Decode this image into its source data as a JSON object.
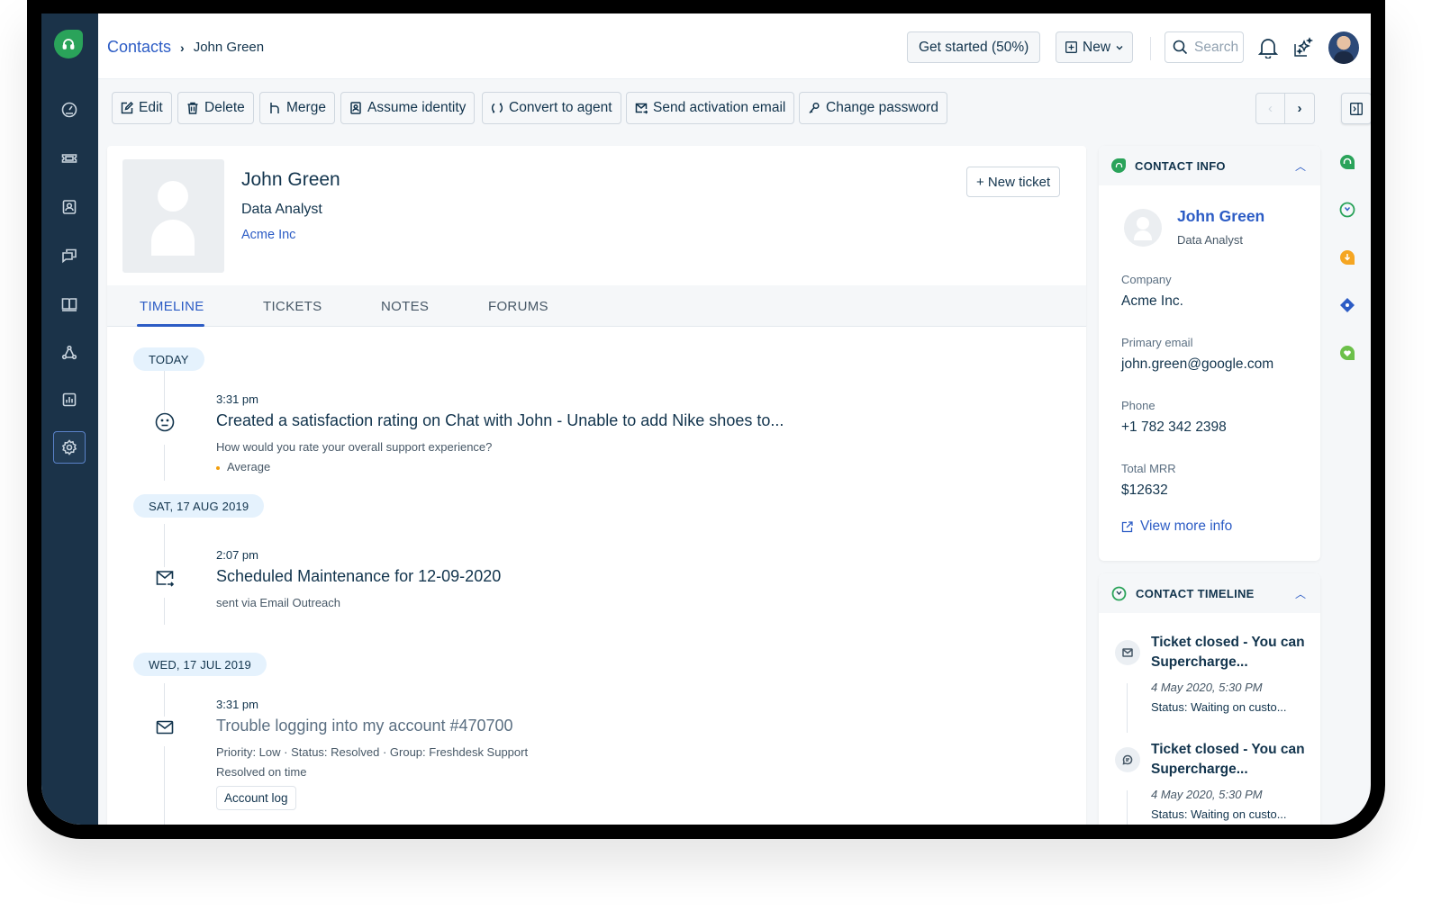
{
  "breadcrumb": {
    "parent": "Contacts",
    "separator": "›",
    "current": "John Green"
  },
  "header": {
    "get_started": "Get started (50%)",
    "new_label": "New",
    "search_placeholder": "Search"
  },
  "sidebar": {
    "items": [
      {
        "name": "dashboard",
        "icon": "gauge-icon"
      },
      {
        "name": "tickets",
        "icon": "ticket-icon"
      },
      {
        "name": "contacts",
        "icon": "contact-card-icon"
      },
      {
        "name": "conversations",
        "icon": "chat-icon"
      },
      {
        "name": "knowledge-base",
        "icon": "book-icon"
      },
      {
        "name": "social",
        "icon": "network-icon"
      },
      {
        "name": "reports",
        "icon": "bar-chart-icon"
      },
      {
        "name": "admin",
        "icon": "gear-icon",
        "active": true
      }
    ]
  },
  "toolbar": {
    "edit": "Edit",
    "delete": "Delete",
    "merge": "Merge",
    "assume_identity": "Assume identity",
    "convert_to_agent": "Convert to agent",
    "send_activation_email": "Send activation email",
    "change_password": "Change password"
  },
  "profile": {
    "name": "John Green",
    "title": "Data Analyst",
    "company": "Acme Inc",
    "new_ticket": "+ New ticket"
  },
  "tabs": [
    {
      "label": "TIMELINE",
      "active": true
    },
    {
      "label": "TICKETS"
    },
    {
      "label": "NOTES"
    },
    {
      "label": "FORUMS"
    }
  ],
  "timeline": {
    "groups": [
      {
        "date": "TODAY",
        "event": {
          "time": "3:31 pm",
          "icon": "smiley-neutral-icon",
          "title": "Created a satisfaction rating on Chat with John - Unable to add Nike shoes to...",
          "question": "How would you rate your overall support experience?",
          "rating": "Average"
        }
      },
      {
        "date": "SAT, 17 AUG 2019",
        "event": {
          "time": "2:07 pm",
          "icon": "email-outgoing-icon",
          "title": "Scheduled Maintenance for 12-09-2020",
          "sub": "sent via Email Outreach"
        }
      },
      {
        "date": "WED, 17 JUL 2019",
        "event": {
          "time": "3:31 pm",
          "icon": "email-icon",
          "title": "Trouble logging into my account #470700",
          "meta": "Priority: Low  ·  Status: Resolved  ·  Group: Freshdesk Support",
          "sub": "Resolved on time",
          "button": "Account log"
        }
      }
    ]
  },
  "contact_info": {
    "heading": "CONTACT INFO",
    "name": "John Green",
    "role": "Data Analyst",
    "fields": [
      {
        "label": "Company",
        "value": "Acme Inc."
      },
      {
        "label": "Primary email",
        "value": "john.green@google.com"
      },
      {
        "label": "Phone",
        "value": "+1 782 342 2398"
      },
      {
        "label": "Total MRR",
        "value": "$12632"
      }
    ],
    "view_more": "View more info"
  },
  "contact_timeline": {
    "heading": "CONTACT TIMELINE",
    "items": [
      {
        "icon": "email-icon",
        "title": "Ticket closed - You can Supercharge...",
        "date": "4 May 2020, 5:30 PM",
        "status": "Status: Waiting on custo..."
      },
      {
        "icon": "chat-bubble-icon",
        "title": "Ticket closed - You can Supercharge...",
        "date": "4 May 2020, 5:30 PM",
        "status": "Status: Waiting on custo..."
      }
    ]
  },
  "app_strip": [
    {
      "name": "freshdesk-app-icon",
      "color": "#2aa35a"
    },
    {
      "name": "timeline-app-icon",
      "color": "#2aa35a"
    },
    {
      "name": "download-app-icon",
      "color": "#f5a623"
    },
    {
      "name": "diamond-app-icon",
      "color": "#2c5cc5"
    },
    {
      "name": "heart-app-icon",
      "color": "#6cc04a"
    }
  ],
  "colors": {
    "accent": "#2c5cc5",
    "brand": "#2aa35a",
    "sidebar": "#1b3349"
  }
}
